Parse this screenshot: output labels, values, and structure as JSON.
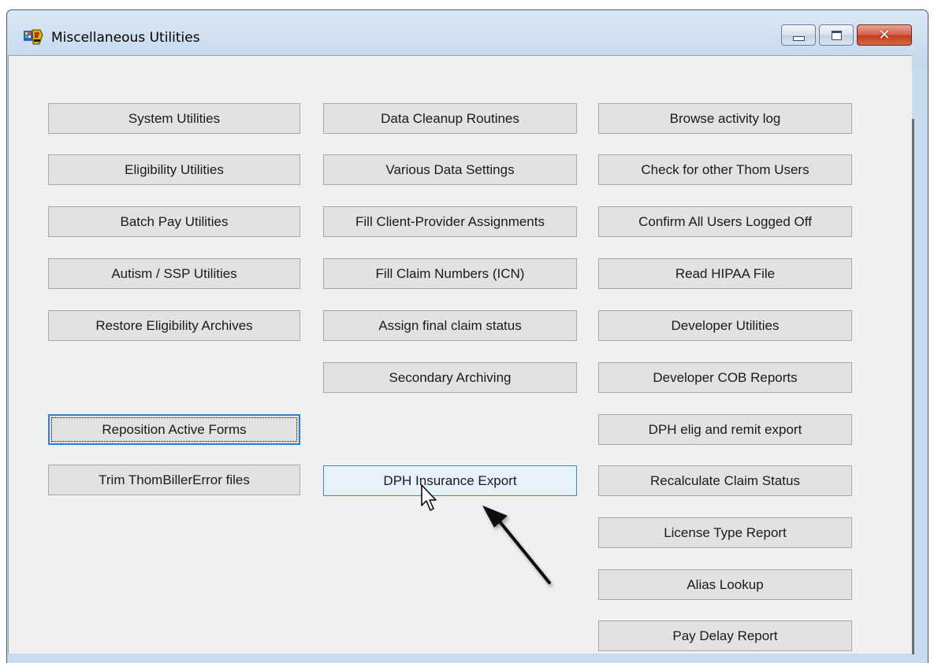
{
  "window": {
    "title": "Miscellaneous Utilities",
    "controls": {
      "close_glyph": "✕"
    }
  },
  "buttons": {
    "col1": [
      {
        "label": "System Utilities",
        "name": "system-utilities-button"
      },
      {
        "label": "Eligibility Utilities",
        "name": "eligibility-utilities-button"
      },
      {
        "label": "Batch Pay Utilities",
        "name": "batch-pay-utilities-button"
      },
      {
        "label": "Autism  / SSP Utilities",
        "name": "autism-ssp-utilities-button"
      },
      {
        "label": "Restore Eligibility Archives",
        "name": "restore-eligibility-archives-button"
      },
      {
        "label": "Reposition Active Forms",
        "name": "reposition-active-forms-button"
      },
      {
        "label": "Trim ThomBillerError files",
        "name": "trim-thombillererror-files-button"
      }
    ],
    "col2": [
      {
        "label": "Data Cleanup Routines",
        "name": "data-cleanup-routines-button"
      },
      {
        "label": "Various Data Settings",
        "name": "various-data-settings-button"
      },
      {
        "label": "Fill Client-Provider Assignments",
        "name": "fill-client-provider-assignments-button"
      },
      {
        "label": "Fill Claim Numbers (ICN)",
        "name": "fill-claim-numbers-button"
      },
      {
        "label": "Assign final claim status",
        "name": "assign-final-claim-status-button"
      },
      {
        "label": "Secondary Archiving",
        "name": "secondary-archiving-button"
      },
      {
        "label": "DPH Insurance Export",
        "name": "dph-insurance-export-button"
      }
    ],
    "col3": [
      {
        "label": "Browse activity log",
        "name": "browse-activity-log-button"
      },
      {
        "label": "Check for other Thom Users",
        "name": "check-other-thom-users-button"
      },
      {
        "label": "Confirm All Users Logged Off",
        "name": "confirm-all-users-logged-off-button"
      },
      {
        "label": "Read HIPAA File",
        "name": "read-hipaa-file-button"
      },
      {
        "label": "Developer Utilities",
        "name": "developer-utilities-button"
      },
      {
        "label": "Developer COB Reports",
        "name": "developer-cob-reports-button"
      },
      {
        "label": "DPH elig and remit export",
        "name": "dph-elig-remit-export-button"
      },
      {
        "label": "Recalculate Claim Status",
        "name": "recalculate-claim-status-button"
      },
      {
        "label": "License Type Report",
        "name": "license-type-report-button"
      },
      {
        "label": "Alias Lookup",
        "name": "alias-lookup-button"
      },
      {
        "label": "Pay Delay Report",
        "name": "pay-delay-report-button"
      }
    ]
  },
  "state": {
    "focused_button": "Reposition Active Forms",
    "hovered_button": "DPH Insurance Export"
  },
  "colors": {
    "focus_border": "#2c7fd8",
    "hover_fill": "#e6f2fb",
    "close_button": "#c23f22"
  },
  "icons": {
    "app": "app-icon",
    "cursor": "mouse-pointer-icon",
    "annotation": "arrow-annotation"
  }
}
